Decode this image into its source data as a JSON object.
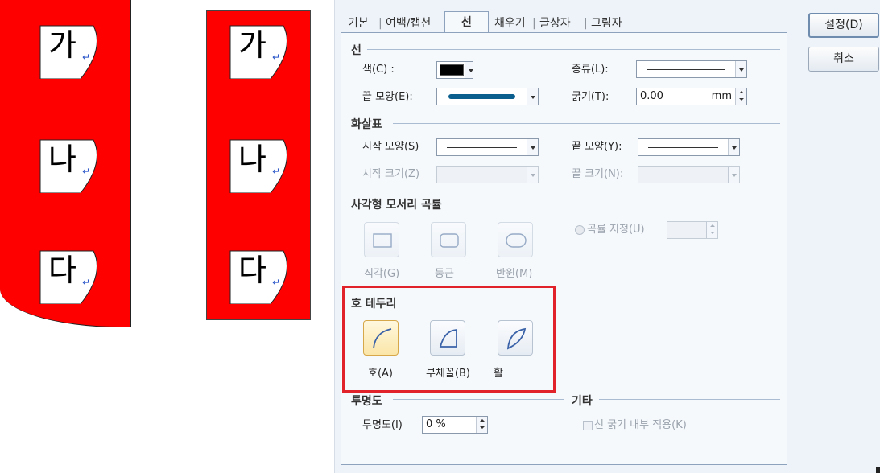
{
  "canvas": {
    "items": [
      {
        "glyph": "가",
        "color": "#ffff00"
      },
      {
        "glyph": "나",
        "color": "#008000"
      },
      {
        "glyph": "다",
        "color": "#3333a0"
      }
    ],
    "return_mark": "↵",
    "background_color": "#ff0000"
  },
  "dialog": {
    "tabs": [
      "기본",
      "여백/캡션",
      "선",
      "채우기",
      "글상자",
      "그림자"
    ],
    "active_tab": "선",
    "buttons": {
      "ok": "설정(D)",
      "cancel": "취소"
    },
    "line": {
      "section": "선",
      "color_label": "색(C) :",
      "color_value": "#000000",
      "type_label": "종류(L):",
      "end_shape_label": "끝 모양(E):",
      "thickness_label": "굵기(T):",
      "thickness_value": "0.00",
      "thickness_unit": "mm"
    },
    "arrow": {
      "section": "화살표",
      "start_shape_label": "시작 모양(S)",
      "end_shape_label": "끝 모양(Y):",
      "start_size_label": "시작 크기(Z)",
      "end_size_label": "끝 크기(N):"
    },
    "corner": {
      "section": "사각형 모서리 곡률",
      "options": [
        "직각(G)",
        "둥근",
        "반원(M)"
      ],
      "custom_label": "곡률 지정(U)"
    },
    "arc_border": {
      "section": "호 테두리",
      "options": [
        "호(A)",
        "부채꼴(B)",
        "활"
      ],
      "selected": "호(A)"
    },
    "transparency": {
      "section": "투명도",
      "label": "투명도(I)",
      "value": "0 %"
    },
    "etc": {
      "section": "기타",
      "inner_thickness_label": "선 굵기 내부 적용(K)"
    }
  }
}
